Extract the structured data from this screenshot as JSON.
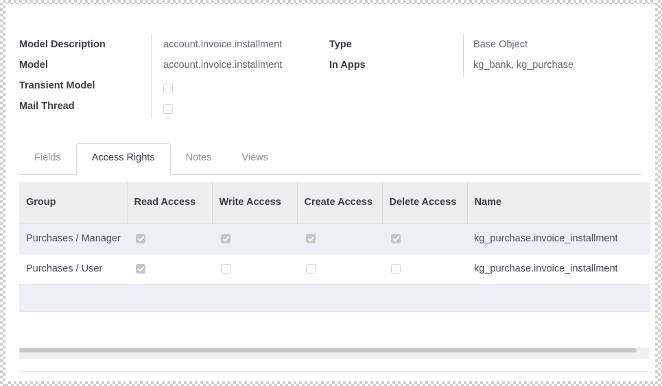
{
  "form": {
    "left_fields": [
      {
        "label": "Model Description",
        "value": "account.invoice.installment",
        "type": "text"
      },
      {
        "label": "Model",
        "value": "account.invoice.installment",
        "type": "text"
      },
      {
        "label": "Transient Model",
        "value": "",
        "type": "checkbox",
        "checked": false
      },
      {
        "label": "Mail Thread",
        "value": "",
        "type": "checkbox",
        "checked": false
      }
    ],
    "right_fields": [
      {
        "label": "Type",
        "value": "Base Object",
        "type": "text"
      },
      {
        "label": "In Apps",
        "value": "kg_bank, kg_purchase",
        "type": "text"
      }
    ]
  },
  "tabs": [
    {
      "label": "Fields",
      "active": false
    },
    {
      "label": "Access Rights",
      "active": true
    },
    {
      "label": "Notes",
      "active": false
    },
    {
      "label": "Views",
      "active": false
    }
  ],
  "table": {
    "columns": [
      {
        "label": "Group"
      },
      {
        "label": "Read Access"
      },
      {
        "label": "Write Access"
      },
      {
        "label": "Create Access"
      },
      {
        "label": "Delete Access"
      },
      {
        "label": "Name"
      }
    ],
    "rows": [
      {
        "group": "Purchases / Manager",
        "read": true,
        "write": true,
        "create": true,
        "delete": true,
        "name": "kg_purchase.invoice_installment"
      },
      {
        "group": "Purchases / User",
        "read": true,
        "write": false,
        "create": false,
        "delete": false,
        "name": "kg_purchase.invoice_installment"
      }
    ],
    "empty_row": true
  },
  "scrollbar": {
    "orientation": "horizontal",
    "thumb_position_percent": 0
  },
  "colors": {
    "row_highlight": "#eeeef7",
    "header_bg": "#eeeeef",
    "label_text": "#3c3c46",
    "value_text": "#666a72",
    "tab_inactive": "#8a8fa0",
    "border": "#dcdce0"
  }
}
